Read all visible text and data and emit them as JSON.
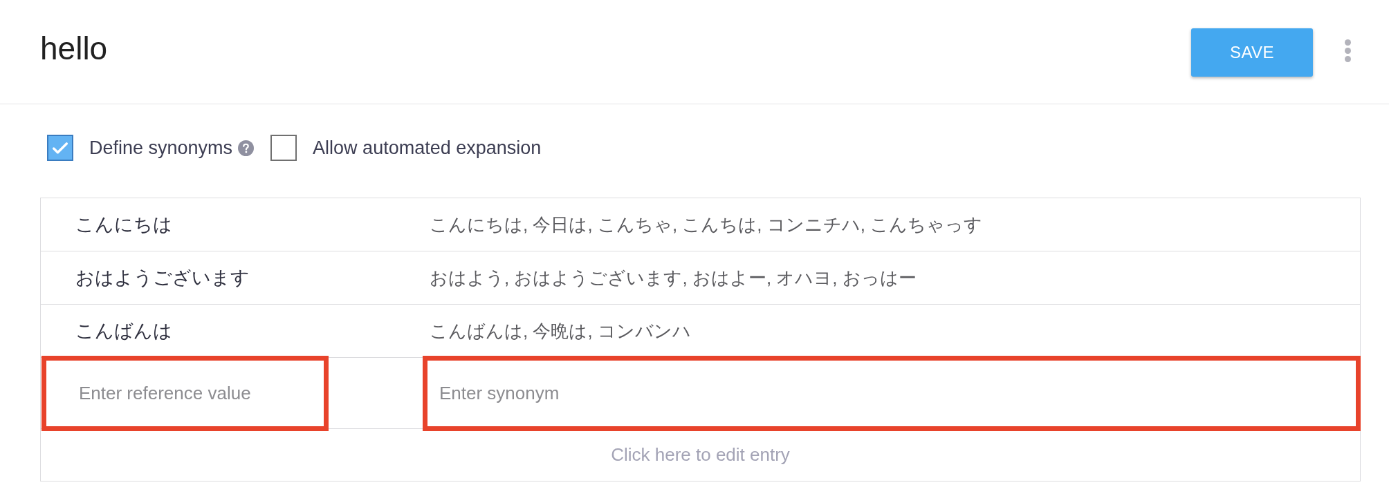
{
  "header": {
    "title": "hello",
    "save_button": "SAVE"
  },
  "options": [
    {
      "label": "Define synonyms",
      "checked": true,
      "help": true
    },
    {
      "label": "Allow automated expansion",
      "checked": false,
      "help": false
    }
  ],
  "entries": [
    {
      "reference": "こんにちは",
      "synonyms": "こんにちは, 今日は, こんちゃ, こんちは, コンニチハ, こんちゃっす"
    },
    {
      "reference": "おはようございます",
      "synonyms": "おはよう, おはようございます, おはよー, オハヨ, おっはー"
    },
    {
      "reference": "こんばんは",
      "synonyms": "こんばんは, 今晩は, コンバンハ"
    }
  ],
  "new_entry": {
    "reference": {
      "placeholder": "Enter reference value",
      "highlighted": true
    },
    "synonyms": {
      "placeholder": "Enter synonym",
      "highlighted": true
    }
  },
  "footer_hint": "Click here to edit entry"
}
